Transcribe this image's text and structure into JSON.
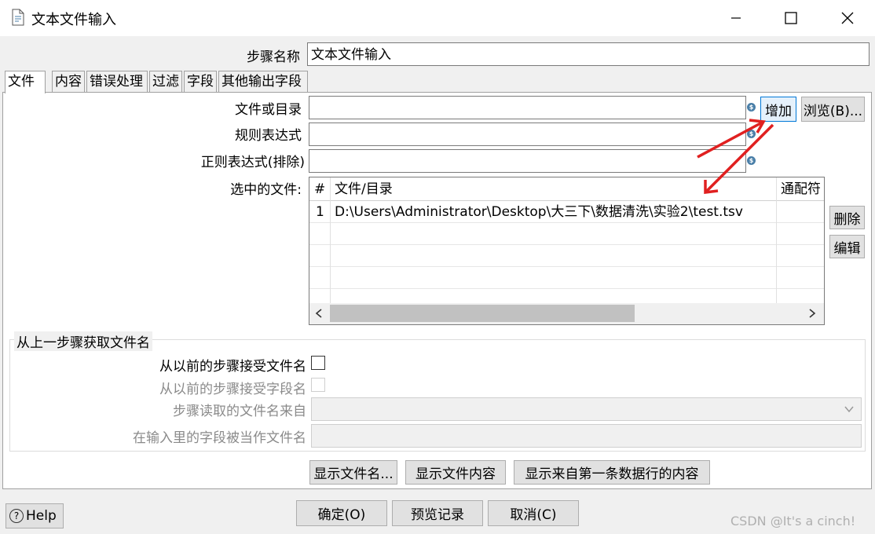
{
  "window": {
    "title": "文本文件输入",
    "icon": "document-icon"
  },
  "step_name": {
    "label": "步骤名称",
    "value": "文本文件输入"
  },
  "tabs": [
    "文件",
    "内容",
    "错误处理",
    "过滤",
    "字段",
    "其他输出字段"
  ],
  "file_tab": {
    "file_or_dir_label": "文件或目录",
    "file_or_dir_value": "",
    "add_button": "增加",
    "browse_button": "浏览(B)...",
    "regex_label": "规则表达式",
    "regex_value": "",
    "regex_exclude_label": "正则表达式(排除)",
    "regex_exclude_value": "",
    "selected_files_label": "选中的文件:",
    "delete_button": "删除",
    "edit_button": "编辑",
    "table": {
      "columns": [
        "#",
        "文件/目录",
        "通配符"
      ],
      "rows": [
        {
          "num": "1",
          "path": "D:\\Users\\Administrator\\Desktop\\大三下\\数据清洗\\实验2\\test.tsv",
          "wildcard": ""
        }
      ]
    }
  },
  "previous_step": {
    "group_title": "从上一步骤获取文件名",
    "accept_filenames_label": "从以前的步骤接受文件名",
    "accept_fieldnames_label": "从以前的步骤接受字段名",
    "step_source_label": "步骤读取的文件名来自",
    "field_as_filename_label": "在输入里的字段被当作文件名"
  },
  "actions": {
    "show_filenames": "显示文件名...",
    "show_file_content": "显示文件内容",
    "show_first_row_content": "显示来自第一条数据行的内容"
  },
  "footer": {
    "help": "Help",
    "ok": "确定(O)",
    "preview": "预览记录",
    "cancel": "取消(C)"
  },
  "watermark": "CSDN @It's a cinch!",
  "colors": {
    "annotation_arrow": "#e02020",
    "focus_border": "#0078d7"
  }
}
